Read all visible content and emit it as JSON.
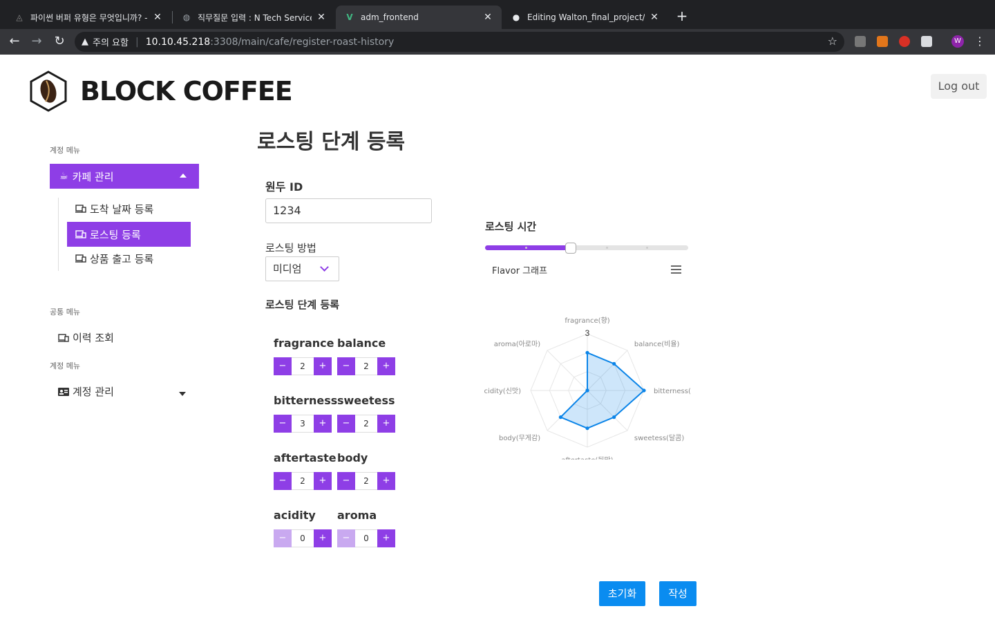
{
  "browser": {
    "tabs": [
      {
        "title": "파이썬 버퍼 유형은 무엇입니까? - 코"
      },
      {
        "title": "직무질문 입력 : N Tech Service 지"
      },
      {
        "title": "adm_frontend"
      },
      {
        "title": "Editing Walton_final_project/RE"
      }
    ],
    "security_warning": "주의 요함",
    "url_host": "10.10.45.218",
    "url_path": ":3308/main/cafe/register-roast-history",
    "profile_initial": "W",
    "new_tab": "+"
  },
  "header": {
    "logo_text": "BLOCK COFFEE",
    "logout_label": "Log out"
  },
  "sidebar": {
    "section_account": "계정 메뉴",
    "cafe_menu": "카페 관리",
    "sub_items": [
      "도착 날짜 등록",
      "로스팅 등록",
      "상품 출고 등록"
    ],
    "section_common": "공통 메뉴",
    "history": "이력 조회",
    "section_account2": "계정 메뉴",
    "account_manage": "계정 관리"
  },
  "main": {
    "title": "로스팅 단계 등록",
    "bean_id_label": "원두 ID",
    "bean_id_value": "1234",
    "method_label": "로스팅 방법",
    "method_value": "미디엄",
    "stage_label": "로스팅 단계 등록",
    "flavors": [
      {
        "name": "fragrance",
        "value": "2"
      },
      {
        "name": "balance",
        "value": "2"
      },
      {
        "name": "bitterness",
        "value": "3"
      },
      {
        "name": "sweetess",
        "value": "2"
      },
      {
        "name": "aftertaste",
        "value": "2"
      },
      {
        "name": "body",
        "value": "2"
      },
      {
        "name": "acidity",
        "value": "0"
      },
      {
        "name": "aroma",
        "value": "0"
      }
    ],
    "minus": "−",
    "plus": "+",
    "roast_time_label": "로스팅 시간",
    "roast_time_fraction": 0.4,
    "chart_title": "Flavor 그래프",
    "reset_label": "초기화",
    "submit_label": "작성"
  },
  "chart_data": {
    "type": "radar",
    "categories": [
      "fragrance(향)",
      "balance(비율)",
      "bitterness(쓴맛)",
      "sweetess(달콤)",
      "aftertaste(뒷맛)",
      "body(무게감)",
      "acidity(신맛)",
      "aroma(아로마)"
    ],
    "values": [
      2,
      2,
      3,
      2,
      2,
      2,
      0,
      0
    ],
    "max_label": "3",
    "ylim": [
      0,
      3
    ],
    "color": "#0a84e8"
  }
}
